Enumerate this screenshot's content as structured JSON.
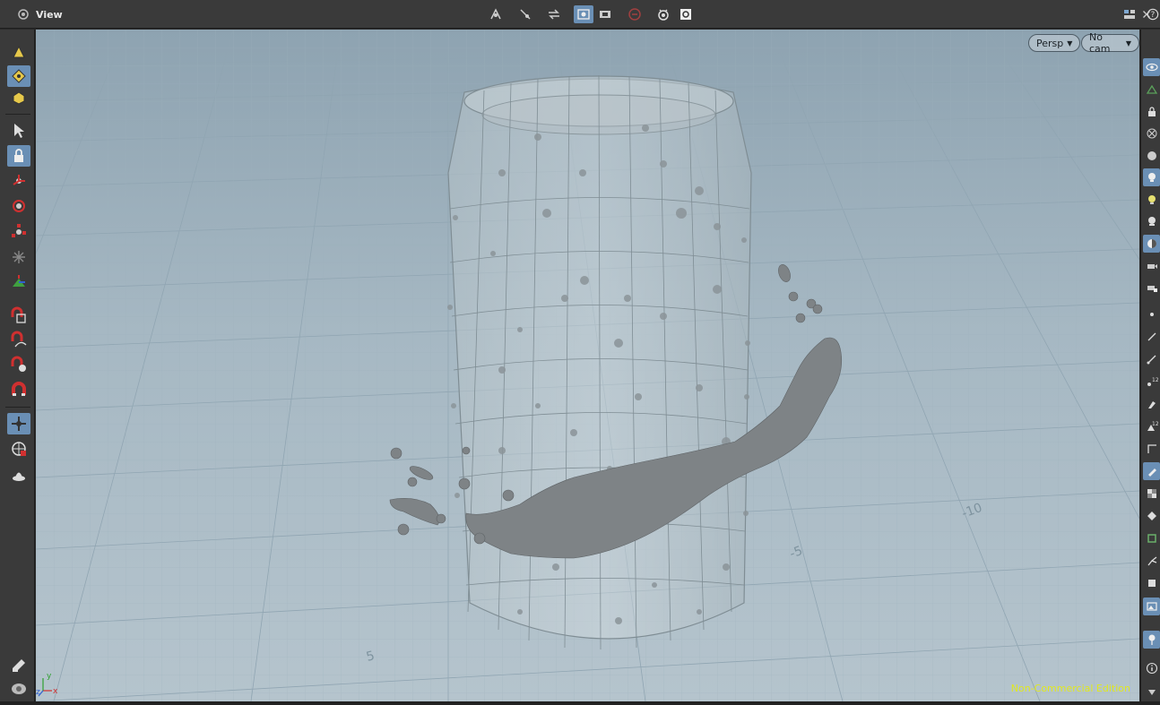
{
  "pane": {
    "title": "View",
    "icon": "view-pane-icon"
  },
  "viewport": {
    "camera_menu": "Persp",
    "cam_menu": "No cam",
    "watermark": "Non-Commercial Edition",
    "grid_labels": [
      "5",
      "-5",
      "-10",
      "5"
    ],
    "axis": {
      "x": "x",
      "y": "y",
      "z": "z"
    }
  },
  "colors": {
    "accent": "#6a8fb5",
    "toolbar_bg": "#3a3a3a",
    "viewport_top": "#8ea3b1",
    "viewport_bottom": "#b5c4cd",
    "watermark": "#e0e820",
    "geometry": "#8a8e90"
  },
  "top_toolbar": [
    {
      "name": "snap-pivot-icon",
      "active": false
    },
    {
      "name": "snap-grid-icon",
      "active": false
    },
    {
      "name": "snap-transform-icon",
      "active": false
    },
    {
      "name": "snapshot-render-icon",
      "active": true
    },
    {
      "name": "camera-view-icon",
      "active": false
    },
    {
      "name": "stop-sign-icon",
      "active": false
    },
    {
      "name": "render-eye-icon",
      "active": false
    },
    {
      "name": "settings-gear-icon",
      "active": false
    }
  ],
  "top_right": [
    {
      "name": "layout-icon"
    },
    {
      "name": "maximize-icon"
    },
    {
      "name": "help-icon"
    }
  ],
  "left_tools": [
    {
      "name": "select-object-icon",
      "active": false
    },
    {
      "name": "select-point-icon",
      "active": true
    },
    {
      "name": "select-prim-icon",
      "active": false
    },
    {
      "name": "select-arrow-icon",
      "active": false
    },
    {
      "name": "lock-icon",
      "active": true
    },
    {
      "name": "transform-icon",
      "active": false
    },
    {
      "name": "rotate-icon",
      "active": false
    },
    {
      "name": "scale-icon",
      "active": false
    },
    {
      "name": "pivot-icon",
      "active": false
    },
    {
      "name": "handle-icon",
      "active": false
    },
    {
      "name": "magnet-box-icon",
      "active": false
    },
    {
      "name": "magnet-curve-icon",
      "active": false
    },
    {
      "name": "magnet-sphere-icon",
      "active": false
    },
    {
      "name": "magnet-icon",
      "active": false
    },
    {
      "name": "view-tool-icon",
      "active": true
    },
    {
      "name": "orbit-icon",
      "active": false
    },
    {
      "name": "light-icon",
      "active": false
    },
    {
      "name": "paint-icon",
      "active": false
    },
    {
      "name": "camera-icon",
      "active": false
    }
  ],
  "right_tools": [
    {
      "name": "eye-icon",
      "active": true
    },
    {
      "name": "ghost-icon",
      "active": false
    },
    {
      "name": "padlock-icon",
      "active": false
    },
    {
      "name": "close-x-icon",
      "active": false
    },
    {
      "name": "sphere-icon",
      "active": false
    },
    {
      "name": "bulb-icon",
      "active": true
    },
    {
      "name": "bulb-green-icon",
      "active": false
    },
    {
      "name": "skull-icon",
      "active": false
    },
    {
      "name": "shading-icon",
      "active": true
    },
    {
      "name": "cam-icon",
      "active": false
    },
    {
      "name": "cam-lock-icon",
      "active": false
    },
    {
      "name": "dot-icon",
      "active": false
    },
    {
      "name": "line-icon",
      "active": false
    },
    {
      "name": "pen-icon",
      "active": false
    },
    {
      "name": "number-icon",
      "active": false
    },
    {
      "name": "brush-icon",
      "active": false
    },
    {
      "name": "number-12-icon",
      "active": false
    },
    {
      "name": "corner-icon",
      "active": false
    },
    {
      "name": "pencil-icon",
      "active": true
    },
    {
      "name": "checker-icon",
      "active": false
    },
    {
      "name": "diamond-icon",
      "active": false
    },
    {
      "name": "frame-icon",
      "active": false
    },
    {
      "name": "branch-icon",
      "active": false
    },
    {
      "name": "square-icon",
      "active": false
    },
    {
      "name": "image-icon",
      "active": true
    },
    {
      "name": "pin-icon",
      "active": true
    },
    {
      "name": "info-icon",
      "active": false
    },
    {
      "name": "arrow-down-icon",
      "active": false
    }
  ]
}
